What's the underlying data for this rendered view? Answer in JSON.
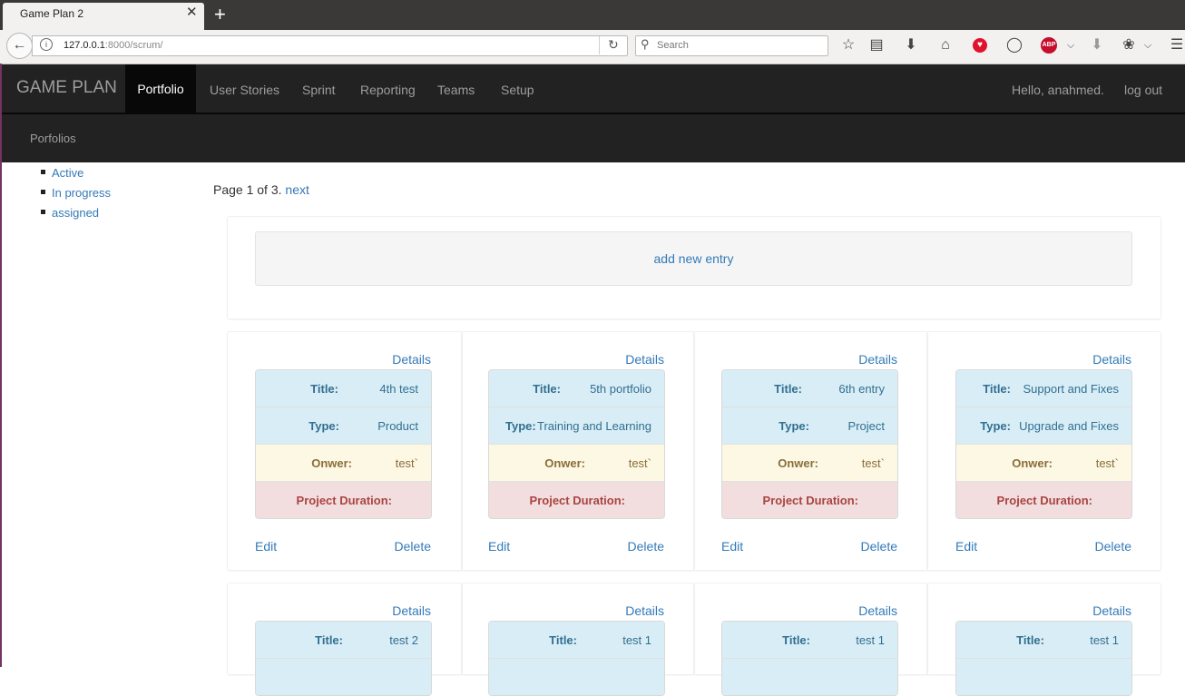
{
  "browser": {
    "tab_title": "Game Plan 2",
    "tab_close": "✕",
    "new_tab": "+",
    "url_host": "127.0.0.1",
    "url_rest": ":8000/scrum/",
    "search_placeholder": "Search"
  },
  "nav": {
    "brand": "GAME PLAN",
    "items": [
      "Portfolio",
      "User Stories",
      "Sprint",
      "Reporting",
      "Teams",
      "Setup"
    ],
    "greeting": "Hello, anahmed.",
    "logout": "log out",
    "subnav": "Porfolios"
  },
  "sidebar": {
    "items": [
      "Active",
      "In progress",
      "assigned"
    ]
  },
  "pager": {
    "text": "Page 1 of 3.",
    "next": "next"
  },
  "add_entry": "add new entry",
  "labels": {
    "details": "Details",
    "title": "Title:",
    "type": "Type:",
    "owner": "Onwer:",
    "duration": "Project Duration:",
    "edit": "Edit",
    "delete": "Delete"
  },
  "cards_row1": [
    {
      "title": "4th test",
      "type": "Product",
      "owner": "test`"
    },
    {
      "title": "5th portfolio",
      "type": "Training and Learning",
      "owner": "test`"
    },
    {
      "title": "6th entry",
      "type": "Project",
      "owner": "test`"
    },
    {
      "title": "Support and Fixes",
      "type": "Upgrade and Fixes",
      "owner": "test`"
    }
  ],
  "cards_row2": [
    {
      "title": "test 2"
    },
    {
      "title": "test 1"
    },
    {
      "title": "test 1"
    },
    {
      "title": "test 1"
    }
  ],
  "colors": {
    "navbar": "#222222",
    "link": "#337ab7",
    "info_row": "#d9edf7",
    "warning_row": "#fcf8e3",
    "danger_row": "#f2dede"
  }
}
